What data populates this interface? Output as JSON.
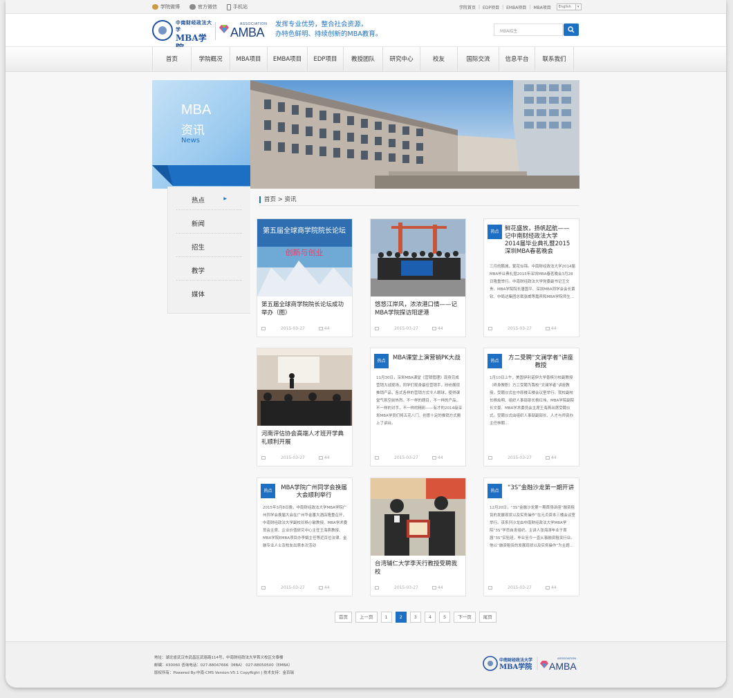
{
  "topbar": {
    "weibo": "学院微博",
    "wechat": "官方微信",
    "mobile": "手机站",
    "links": [
      "学院首页",
      "EDP项目",
      "EMBA项目",
      "MBA项目"
    ],
    "language": "English"
  },
  "header": {
    "logo_cn_small": "中南财经政法大学",
    "logo_cn_big": "MBA学院",
    "amba_assoc": "ASSOCIATION",
    "amba_word": "AMBA",
    "slogan_line1": "发挥专业优势，整合社会资源，",
    "slogan_line2": "办特色鲜明、持续创新的MBA教育。",
    "search_placeholder": "MBA招生"
  },
  "nav": [
    "首页",
    "学院概况",
    "MBA项目",
    "EMBA项目",
    "EDP项目",
    "教授团队",
    "研究中心",
    "校友",
    "国际交流",
    "信息平台",
    "联系我们"
  ],
  "banner": {
    "title1": "MBA",
    "title2": "资讯",
    "title3": "News"
  },
  "sidebar": [
    "热点",
    "新闻",
    "招生",
    "教学",
    "媒体"
  ],
  "breadcrumb": "首页 > 资讯",
  "hot_label": "热点",
  "cards": [
    {
      "title": "第五届全球商学院院长论坛成功举办（图）",
      "date": "2015-03-27",
      "views": "44"
    },
    {
      "title": "悠悠江岸风，浓浓港口情——记MBA学院探访阳逻港",
      "date": "2015-03-27",
      "views": "44"
    },
    {
      "title": "鲜花盛放，扬帆起航——记中南财经政法大学2014届毕业典礼暨2015深圳MBA春茗晚会",
      "excerpt": "三月的鹏城，繁花似锦。中南财经政法大学2014届MBA毕业典礼暨2015年深圳MBA春茗晚会3月28日隆重举行。中南财经政法大学党委副书记王文贵、MBA学院院长唐国平、深圳MBA同学会会长黄钦、中局达集团总裁张威等嘉宾和MBA学院师生...",
      "date": "2015-03-27",
      "views": "44"
    },
    {
      "title": "河南评估协会高端人才班开学典礼顺利开展",
      "date": "2015-03-27",
      "views": "44"
    },
    {
      "title": "MBA课堂上演营销PK大战",
      "excerpt": "11月30日，深圳MBA课堂《营销管理》现身完成营销大战现场，同学们现身最佳营销手，纷纷展现推销产品，各式各样的营销方式令人眼球，使得课堂气氛空前热烈。不一样的题目，不一样的产品，不一样的对手，不一样的精彩——有才的2014级深圳MBA学员们将五花八门、创意十足的推销方式搬上了讲台。",
      "date": "2015-03-27",
      "views": "44"
    },
    {
      "title": "方二受聘“文澜学者”讲座教授",
      "excerpt": "1月10日上午，美国伊利诺伊大学香槟分校副教授（终身教职）方二受聘为我校“文澜学者”讲座教授，受聘仪式在中原楼五楼会议室举行。我校副校长杨灿明、组织人事部部长杨红伟、MBA学院副院长文豪、MBA学术委员会主席王海燕出席受聘仪式。受聘仪式由组织人事部副部长、人才与师资办主任林朝...",
      "date": "2015-03-27",
      "views": "44"
    },
    {
      "title": "MBA学院广州同学会换届大会顺利举行",
      "excerpt": "2015年3月8日晚，中南财经政法大学MBA学院广州同学会换届大会在广州华金番大酒店隆重召开，中南财经政法大学副校长杨小敏教授、MBA学术委员会主席、企业价值研究中心主任王海燕教授、MBA学院EMBA项目办李娟主任等近百位法律、金融专业人士及校友出席本次活动",
      "date": "2015-03-27",
      "views": "44"
    },
    {
      "title": "台湾辅仁大学李天行教授受聘我校",
      "date": "2015-03-27",
      "views": "44"
    },
    {
      "title": "“3S”金融沙龙第一期开讲",
      "excerpt": "12月20日，“3S”金融沙龙第一期首场讲座“融资租赁的发展现状以及实务操作”在元贞资本三楼会议室举行。该系列沙龙由中南财经政法大学MBA学院“3S”学员自发组织。主讲人张海涛毕业于首届“3S”实验班，毕业至今一直从事融资租赁行业。他以“融资租赁的发展现状以及实务操作”为主题...",
      "date": "2015-03-27",
      "views": "44"
    }
  ],
  "pager": [
    "首页",
    "上一页",
    "1",
    "2",
    "3",
    "4",
    "5",
    "下一页",
    "尾页"
  ],
  "pager_current": "2",
  "photo_captions": {
    "forum_title": "第五届全球商学院院长论坛",
    "forum_sub": "创新与创业"
  },
  "footer": {
    "line1": "地址：湖北省武汉市武昌区武珞路114号，中南财经政法大学首义校区文泰楼",
    "line2": "邮编：430060     咨询电话：027-88047666（MBA） 027-88050500（EMBA）",
    "line3": "版权所有：Powered By:中南-CMS Version:V5.1 CopyRight | 技术支持：金百瑞",
    "logo_cn_small": "中南财经政法大学",
    "logo_cn_big": "MBA学院",
    "amba_assoc": "ASSOCIATION",
    "amba_word": "AMBA"
  },
  "colors": {
    "accent": "#1c6fc2",
    "brand_dark": "#1c4f9c"
  }
}
